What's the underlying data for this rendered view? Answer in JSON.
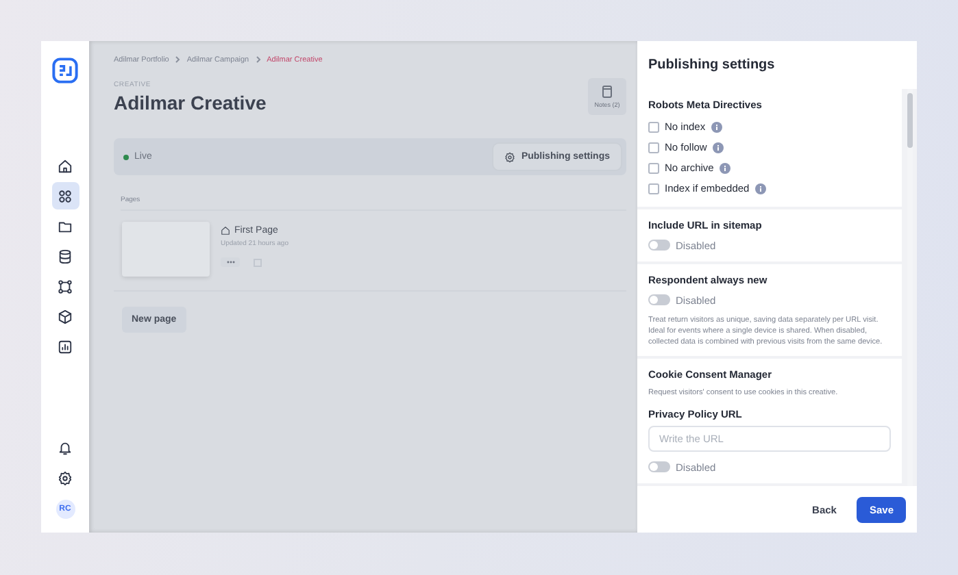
{
  "sidebar": {
    "items": [
      {
        "selected": false
      },
      {
        "selected": true
      },
      {
        "selected": false
      },
      {
        "selected": false
      },
      {
        "selected": false
      },
      {
        "selected": false
      },
      {
        "selected": false
      }
    ],
    "avatar": "RC"
  },
  "breadcrumbs": [
    {
      "label": "Adilmar Portfolio",
      "current": false
    },
    {
      "label": "Adilmar Campaign",
      "current": false
    },
    {
      "label": "Adilmar Creative",
      "current": true
    }
  ],
  "header": {
    "eyebrow": "CREATIVE",
    "title": "Adilmar Creative",
    "notes_button": "Notes (2)"
  },
  "status_bar": {
    "status": "Live",
    "button": "Publishing settings"
  },
  "pages": {
    "label": "Pages",
    "items": [
      {
        "title": "First Page",
        "updated": "Updated 21 hours ago"
      }
    ],
    "new_button": "New page"
  },
  "panel": {
    "title": "Publishing settings",
    "sections": [
      {
        "kind": "checkboxes",
        "title": "Robots Meta Directives",
        "options": [
          {
            "label": "No index",
            "checked": false
          },
          {
            "label": "No follow",
            "checked": false
          },
          {
            "label": "No archive",
            "checked": false
          },
          {
            "label": "Index if embedded",
            "checked": false
          }
        ]
      },
      {
        "kind": "toggle",
        "title": "Include URL in sitemap",
        "toggle": {
          "on": false,
          "label": "Disabled"
        }
      },
      {
        "kind": "toggle",
        "title": "Respondent always new",
        "toggle": {
          "on": false,
          "label": "Disabled"
        },
        "description": "Treat return visitors as unique, saving data separately per URL visit. Ideal for events where a single device is shared. When disabled, collected data is combined with previous visits from the same device."
      },
      {
        "kind": "cookie",
        "title": "Cookie Consent Manager",
        "description": "Request visitors' consent to use cookies in this creative.",
        "field": {
          "label": "Privacy Policy URL",
          "placeholder": "Write the URL"
        },
        "toggle": {
          "on": false,
          "label": "Disabled"
        }
      }
    ],
    "buttons": [
      {
        "kind": "secondary",
        "label": "Back"
      },
      {
        "kind": "primary",
        "label": "Save"
      }
    ]
  }
}
